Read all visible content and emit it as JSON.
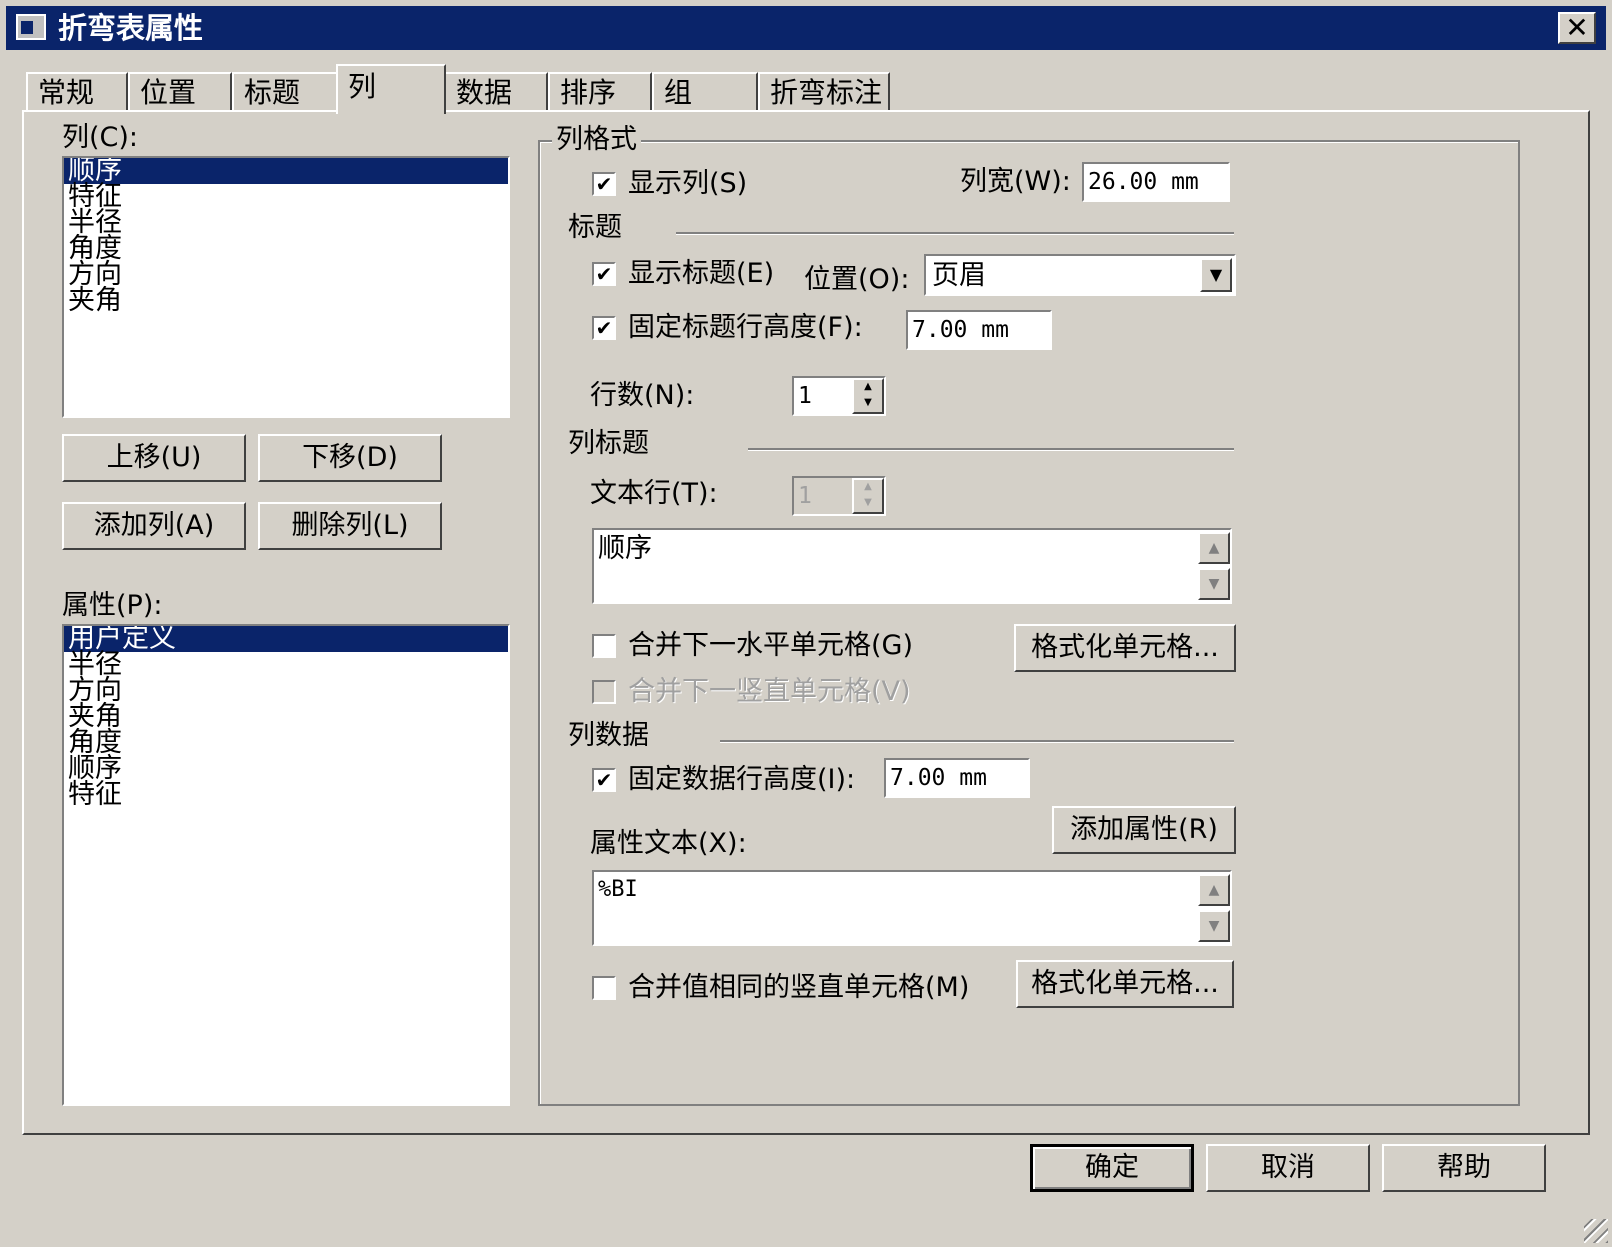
{
  "window": {
    "title": "折弯表属性",
    "close_symbol": "✕"
  },
  "tabs": [
    {
      "label": "常规"
    },
    {
      "label": "位置"
    },
    {
      "label": "标题"
    },
    {
      "label": "列"
    },
    {
      "label": "数据"
    },
    {
      "label": "排序"
    },
    {
      "label": "组"
    },
    {
      "label": "折弯标注"
    }
  ],
  "columns": {
    "label": "列(C):",
    "items": [
      "顺序",
      "特征",
      "半径",
      "角度",
      "方向",
      "夹角"
    ],
    "selected": "顺序"
  },
  "column_buttons": {
    "move_up": "上移(U)",
    "move_down": "下移(D)",
    "add": "添加列(A)",
    "delete": "删除列(L)"
  },
  "properties": {
    "label": "属性(P):",
    "items": [
      "用户定义",
      "半径",
      "方向",
      "夹角",
      "角度",
      "顺序",
      "特征"
    ],
    "selected": "用户定义"
  },
  "column_format": {
    "group_label": "列格式",
    "show_column": {
      "label": "显示列(S)",
      "checked": true
    },
    "column_width": {
      "label": "列宽(W):",
      "value": "26.00 mm"
    },
    "header_section": "标题",
    "show_header": {
      "label": "显示标题(E)",
      "checked": true
    },
    "position": {
      "label": "位置(O):",
      "value": "页眉"
    },
    "fixed_header_height": {
      "label": "固定标题行高度(F):",
      "checked": true,
      "value": "7.00 mm"
    },
    "rows": {
      "label": "行数(N):",
      "value": "1"
    },
    "column_header_section": "列标题",
    "text_row": {
      "label": "文本行(T):",
      "value": "1"
    },
    "header_text": "顺序",
    "merge_horizontal": {
      "label": "合并下一水平单元格(G)",
      "checked": false
    },
    "format_cell_1": "格式化单元格...",
    "merge_vertical": {
      "label": "合并下一竖直单元格(V)",
      "checked": false,
      "disabled": true
    },
    "column_data_section": "列数据",
    "fixed_data_height": {
      "label": "固定数据行高度(I):",
      "checked": true,
      "value": "7.00 mm"
    },
    "property_text": {
      "label": "属性文本(X):",
      "value": "%BI"
    },
    "add_property": "添加属性(R)",
    "merge_same_vertical": {
      "label": "合并值相同的竖直单元格(M)",
      "checked": false
    },
    "format_cell_2": "格式化单元格..."
  },
  "footer": {
    "ok": "确定",
    "cancel": "取消",
    "help": "帮助"
  },
  "icons": {
    "check": "✔",
    "arrow_up": "▲",
    "arrow_down": "▼"
  }
}
